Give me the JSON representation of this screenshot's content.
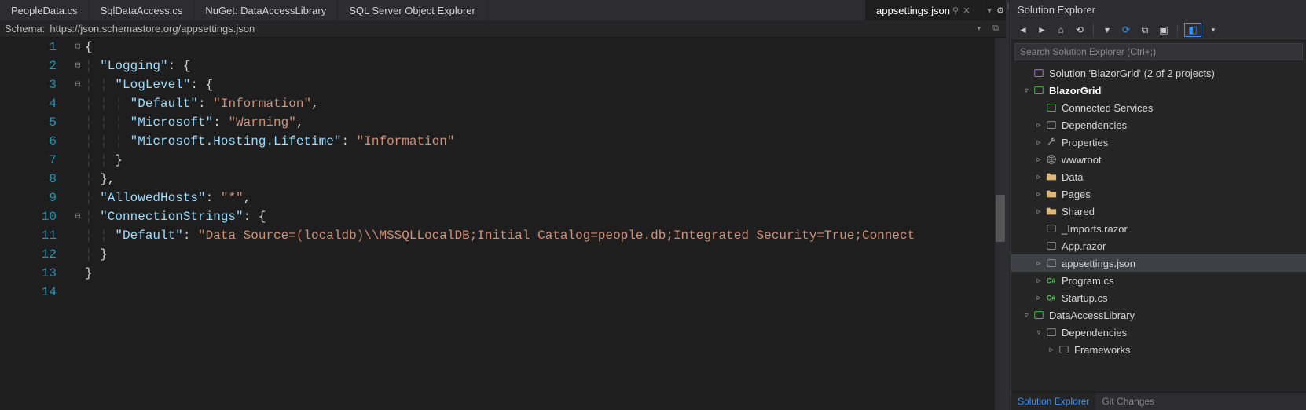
{
  "tabs": {
    "items": [
      "PeopleData.cs",
      "SqlDataAccess.cs",
      "NuGet: DataAccessLibrary",
      "SQL Server Object Explorer"
    ],
    "active": "appsettings.json"
  },
  "schema": {
    "label": "Schema:",
    "url": "https://json.schemastore.org/appsettings.json"
  },
  "code": {
    "lines": [
      {
        "n": 1,
        "fold": "⊟",
        "ind": 0,
        "segs": [
          {
            "t": "{",
            "c": "brace"
          }
        ]
      },
      {
        "n": 2,
        "fold": "⊟",
        "ind": 1,
        "segs": [
          {
            "t": "\"Logging\"",
            "c": "key"
          },
          {
            "t": ": {",
            "c": "punct"
          }
        ]
      },
      {
        "n": 3,
        "fold": "⊟",
        "ind": 2,
        "segs": [
          {
            "t": "\"LogLevel\"",
            "c": "key"
          },
          {
            "t": ": {",
            "c": "punct"
          }
        ]
      },
      {
        "n": 4,
        "fold": "",
        "ind": 3,
        "segs": [
          {
            "t": "\"Default\"",
            "c": "key"
          },
          {
            "t": ": ",
            "c": "punct"
          },
          {
            "t": "\"Information\"",
            "c": "str"
          },
          {
            "t": ",",
            "c": "punct"
          }
        ]
      },
      {
        "n": 5,
        "fold": "",
        "ind": 3,
        "segs": [
          {
            "t": "\"Microsoft\"",
            "c": "key"
          },
          {
            "t": ": ",
            "c": "punct"
          },
          {
            "t": "\"Warning\"",
            "c": "str"
          },
          {
            "t": ",",
            "c": "punct"
          }
        ]
      },
      {
        "n": 6,
        "fold": "",
        "ind": 3,
        "segs": [
          {
            "t": "\"Microsoft.Hosting.Lifetime\"",
            "c": "key"
          },
          {
            "t": ": ",
            "c": "punct"
          },
          {
            "t": "\"Information\"",
            "c": "str"
          }
        ]
      },
      {
        "n": 7,
        "fold": "",
        "ind": 2,
        "segs": [
          {
            "t": "}",
            "c": "brace"
          }
        ]
      },
      {
        "n": 8,
        "fold": "",
        "ind": 1,
        "segs": [
          {
            "t": "},",
            "c": "brace"
          }
        ]
      },
      {
        "n": 9,
        "fold": "",
        "ind": 1,
        "segs": [
          {
            "t": "\"AllowedHosts\"",
            "c": "key"
          },
          {
            "t": ": ",
            "c": "punct"
          },
          {
            "t": "\"*\"",
            "c": "str"
          },
          {
            "t": ",",
            "c": "punct"
          }
        ]
      },
      {
        "n": 10,
        "fold": "⊟",
        "ind": 1,
        "segs": [
          {
            "t": "\"ConnectionStrings\"",
            "c": "key"
          },
          {
            "t": ": {",
            "c": "punct"
          }
        ]
      },
      {
        "n": 11,
        "fold": "",
        "ind": 2,
        "segs": [
          {
            "t": "\"Default\"",
            "c": "key"
          },
          {
            "t": ": ",
            "c": "punct"
          },
          {
            "t": "\"Data Source=(localdb)\\\\MSSQLLocalDB;Initial Catalog=people.db;Integrated Security=True;Connect",
            "c": "str"
          }
        ]
      },
      {
        "n": 12,
        "fold": "",
        "ind": 1,
        "segs": [
          {
            "t": "}",
            "c": "brace"
          }
        ]
      },
      {
        "n": 13,
        "fold": "",
        "ind": 0,
        "segs": [
          {
            "t": "}",
            "c": "brace"
          }
        ]
      },
      {
        "n": 14,
        "fold": "",
        "ind": 0,
        "segs": []
      }
    ]
  },
  "explorer": {
    "title": "Solution Explorer",
    "search_placeholder": "Search Solution Explorer (Ctrl+;)",
    "bottom_tabs": [
      "Solution Explorer",
      "Git Changes"
    ],
    "tree": [
      {
        "depth": 0,
        "arrow": "",
        "icon": "solution",
        "label": "Solution 'BlazorGrid' (2 of 2 projects)"
      },
      {
        "depth": 0,
        "arrow": "▿",
        "icon": "project",
        "label": "BlazorGrid",
        "bold": true
      },
      {
        "depth": 1,
        "arrow": "",
        "icon": "connected",
        "label": "Connected Services"
      },
      {
        "depth": 1,
        "arrow": "▹",
        "icon": "deps",
        "label": "Dependencies"
      },
      {
        "depth": 1,
        "arrow": "▹",
        "icon": "wrench",
        "label": "Properties"
      },
      {
        "depth": 1,
        "arrow": "▹",
        "icon": "globe",
        "label": "wwwroot"
      },
      {
        "depth": 1,
        "arrow": "▹",
        "icon": "folder",
        "label": "Data"
      },
      {
        "depth": 1,
        "arrow": "▹",
        "icon": "folder",
        "label": "Pages"
      },
      {
        "depth": 1,
        "arrow": "▹",
        "icon": "folder",
        "label": "Shared"
      },
      {
        "depth": 1,
        "arrow": "",
        "icon": "razor",
        "label": "_Imports.razor"
      },
      {
        "depth": 1,
        "arrow": "",
        "icon": "razor",
        "label": "App.razor"
      },
      {
        "depth": 1,
        "arrow": "▹",
        "icon": "json",
        "label": "appsettings.json",
        "selected": true
      },
      {
        "depth": 1,
        "arrow": "▹",
        "icon": "cs",
        "label": "Program.cs"
      },
      {
        "depth": 1,
        "arrow": "▹",
        "icon": "cs",
        "label": "Startup.cs"
      },
      {
        "depth": 0,
        "arrow": "▿",
        "icon": "library",
        "label": "DataAccessLibrary"
      },
      {
        "depth": 1,
        "arrow": "▿",
        "icon": "deps",
        "label": "Dependencies"
      },
      {
        "depth": 2,
        "arrow": "▹",
        "icon": "frame",
        "label": "Frameworks"
      }
    ]
  }
}
